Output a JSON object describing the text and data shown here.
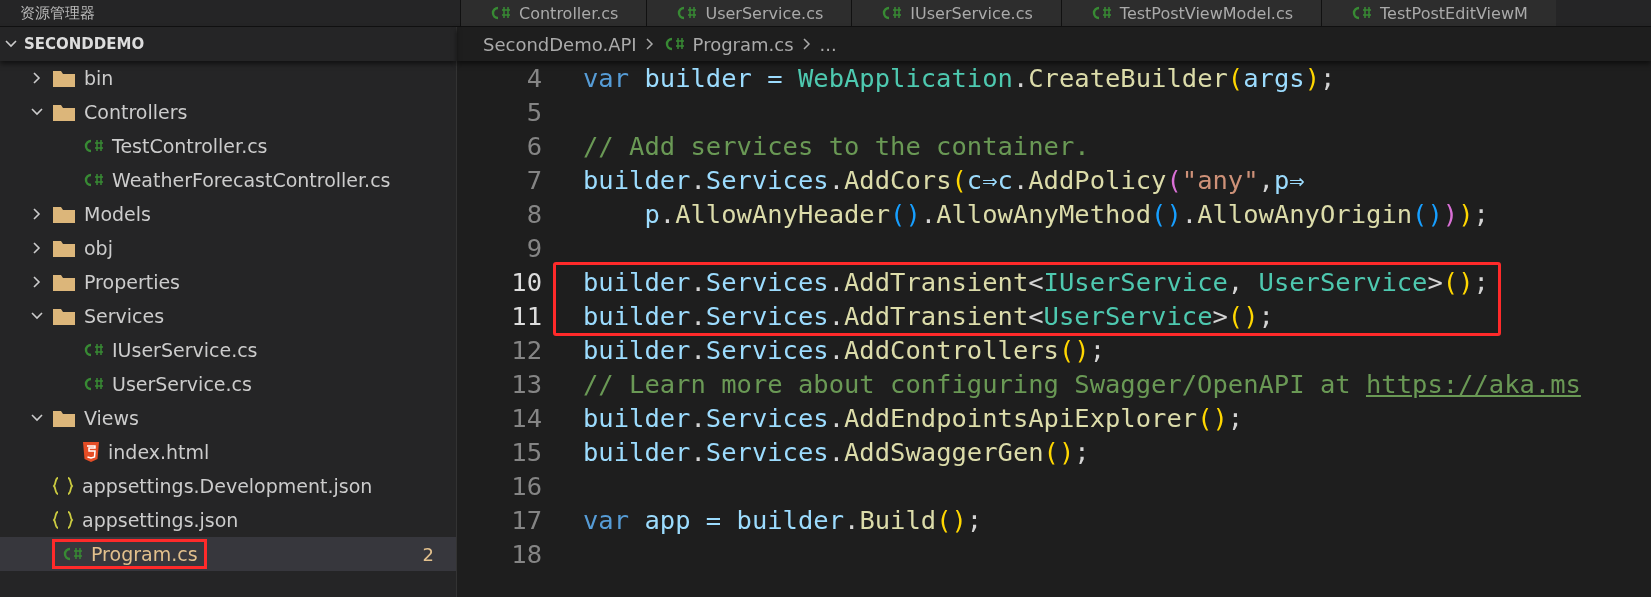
{
  "explorer": {
    "title": "资源管理器",
    "project": "SECONDDEMO"
  },
  "tabs": [
    {
      "label": "Controller.cs",
      "kind": "csharp"
    },
    {
      "label": "UserService.cs",
      "kind": "csharp"
    },
    {
      "label": "IUserService.cs",
      "kind": "csharp"
    },
    {
      "label": "TestPostViewModel.cs",
      "kind": "csharp"
    },
    {
      "label": "TestPostEditViewM",
      "kind": "csharp"
    }
  ],
  "tree": [
    {
      "label": "bin",
      "kind": "folder",
      "expanded": false,
      "selected": false
    },
    {
      "label": "Controllers",
      "kind": "folder",
      "expanded": true,
      "selected": false,
      "children": [
        {
          "label": "TestController.cs",
          "kind": "csharp",
          "selected": false
        },
        {
          "label": "WeatherForecastController.cs",
          "kind": "csharp",
          "selected": false
        }
      ]
    },
    {
      "label": "Models",
      "kind": "folder",
      "expanded": false,
      "selected": false
    },
    {
      "label": "obj",
      "kind": "folder",
      "expanded": false,
      "selected": false
    },
    {
      "label": "Properties",
      "kind": "folder",
      "expanded": false,
      "selected": false
    },
    {
      "label": "Services",
      "kind": "folder",
      "expanded": true,
      "selected": false,
      "children": [
        {
          "label": "IUserService.cs",
          "kind": "csharp",
          "selected": false
        },
        {
          "label": "UserService.cs",
          "kind": "csharp",
          "selected": false
        }
      ]
    },
    {
      "label": "Views",
      "kind": "folder",
      "expanded": true,
      "selected": false,
      "children": [
        {
          "label": "index.html",
          "kind": "html",
          "selected": false
        }
      ]
    },
    {
      "label": "appsettings.Development.json",
      "kind": "json",
      "selected": false
    },
    {
      "label": "appsettings.json",
      "kind": "json",
      "selected": false
    },
    {
      "label": "Program.cs",
      "kind": "csharp",
      "selected": true,
      "boxed": true,
      "badge": "2"
    }
  ],
  "breadcrumb": [
    "SecondDemo.API",
    "Program.cs",
    "..."
  ],
  "code": [
    {
      "number": "4",
      "boxed": false,
      "tokens": [
        {
          "kind": "kw",
          "text": "var "
        },
        {
          "kind": "id",
          "text": "builder = "
        },
        {
          "kind": "type",
          "text": "WebApplication"
        },
        {
          "kind": "p",
          "text": "."
        },
        {
          "kind": "fn",
          "text": "CreateBuilder"
        },
        {
          "kind": "b1",
          "text": "("
        },
        {
          "kind": "id",
          "text": "args"
        },
        {
          "kind": "b1",
          "text": ")"
        },
        {
          "kind": "p",
          "text": ";"
        }
      ]
    },
    {
      "number": "5",
      "boxed": false
    },
    {
      "number": "6",
      "boxed": false,
      "tokens": [
        {
          "kind": "cm",
          "text": "// Add services to the container."
        }
      ]
    },
    {
      "number": "7",
      "boxed": false,
      "tokens": [
        {
          "kind": "id",
          "text": "builder"
        },
        {
          "kind": "p",
          "text": "."
        },
        {
          "kind": "id",
          "text": "Services"
        },
        {
          "kind": "p",
          "text": "."
        },
        {
          "kind": "fn",
          "text": "AddCors"
        },
        {
          "kind": "b1",
          "text": "("
        },
        {
          "kind": "id",
          "text": "c⇒c"
        },
        {
          "kind": "p",
          "text": "."
        },
        {
          "kind": "fn",
          "text": "AddPolicy"
        },
        {
          "kind": "b2",
          "text": "("
        },
        {
          "kind": "str",
          "text": "\"any\""
        },
        {
          "kind": "p",
          "text": ","
        },
        {
          "kind": "id",
          "text": "p⇒"
        }
      ]
    },
    {
      "number": "8",
      "boxed": false,
      "tokens": [
        {
          "kind": "id",
          "text": "    p"
        },
        {
          "kind": "p",
          "text": "."
        },
        {
          "kind": "fn",
          "text": "AllowAnyHeader"
        },
        {
          "kind": "b3",
          "text": "()"
        },
        {
          "kind": "p",
          "text": "."
        },
        {
          "kind": "fn",
          "text": "AllowAnyMethod"
        },
        {
          "kind": "b3",
          "text": "()"
        },
        {
          "kind": "p",
          "text": "."
        },
        {
          "kind": "fn",
          "text": "AllowAnyOrigin"
        },
        {
          "kind": "b3",
          "text": "()"
        },
        {
          "kind": "b2",
          "text": ")"
        },
        {
          "kind": "b1",
          "text": ")"
        },
        {
          "kind": "p",
          "text": ";"
        }
      ]
    },
    {
      "number": "9",
      "boxed": false
    },
    {
      "number": "10",
      "boxed": true,
      "tokens": [
        {
          "kind": "id",
          "text": "builder"
        },
        {
          "kind": "p",
          "text": "."
        },
        {
          "kind": "id",
          "text": "Services"
        },
        {
          "kind": "p",
          "text": "."
        },
        {
          "kind": "fn",
          "text": "AddTransient"
        },
        {
          "kind": "p",
          "text": "<"
        },
        {
          "kind": "type",
          "text": "IUserService"
        },
        {
          "kind": "p",
          "text": ", "
        },
        {
          "kind": "type",
          "text": "UserService"
        },
        {
          "kind": "p",
          "text": ">"
        },
        {
          "kind": "b1",
          "text": "()"
        },
        {
          "kind": "p",
          "text": ";"
        }
      ]
    },
    {
      "number": "11",
      "boxed": true,
      "tokens": [
        {
          "kind": "id",
          "text": "builder"
        },
        {
          "kind": "p",
          "text": "."
        },
        {
          "kind": "id",
          "text": "Services"
        },
        {
          "kind": "p",
          "text": "."
        },
        {
          "kind": "fn",
          "text": "AddTransient"
        },
        {
          "kind": "p",
          "text": "<"
        },
        {
          "kind": "type",
          "text": "UserService"
        },
        {
          "kind": "p",
          "text": ">"
        },
        {
          "kind": "b1",
          "text": "()"
        },
        {
          "kind": "p",
          "text": ";"
        }
      ]
    },
    {
      "number": "12",
      "boxed": false,
      "tokens": [
        {
          "kind": "id",
          "text": "builder"
        },
        {
          "kind": "p",
          "text": "."
        },
        {
          "kind": "id",
          "text": "Services"
        },
        {
          "kind": "p",
          "text": "."
        },
        {
          "kind": "fn",
          "text": "AddControllers"
        },
        {
          "kind": "b1",
          "text": "()"
        },
        {
          "kind": "p",
          "text": ";"
        }
      ]
    },
    {
      "number": "13",
      "boxed": false,
      "tokens": [
        {
          "kind": "cm",
          "text": "// Learn more about configuring Swagger/OpenAPI at "
        },
        {
          "kind": "link",
          "text": "https://aka.ms"
        }
      ]
    },
    {
      "number": "14",
      "boxed": false,
      "tokens": [
        {
          "kind": "id",
          "text": "builder"
        },
        {
          "kind": "p",
          "text": "."
        },
        {
          "kind": "id",
          "text": "Services"
        },
        {
          "kind": "p",
          "text": "."
        },
        {
          "kind": "fn",
          "text": "AddEndpointsApiExplorer"
        },
        {
          "kind": "b1",
          "text": "()"
        },
        {
          "kind": "p",
          "text": ";"
        }
      ]
    },
    {
      "number": "15",
      "boxed": false,
      "tokens": [
        {
          "kind": "id",
          "text": "builder"
        },
        {
          "kind": "p",
          "text": "."
        },
        {
          "kind": "id",
          "text": "Services"
        },
        {
          "kind": "p",
          "text": "."
        },
        {
          "kind": "fn",
          "text": "AddSwaggerGen"
        },
        {
          "kind": "b1",
          "text": "()"
        },
        {
          "kind": "p",
          "text": ";"
        }
      ]
    },
    {
      "number": "16",
      "boxed": false
    },
    {
      "number": "17",
      "boxed": false,
      "tokens": [
        {
          "kind": "kw",
          "text": "var "
        },
        {
          "kind": "id",
          "text": "app = builder"
        },
        {
          "kind": "p",
          "text": "."
        },
        {
          "kind": "fn",
          "text": "Build"
        },
        {
          "kind": "b1",
          "text": "()"
        },
        {
          "kind": "p",
          "text": ";"
        }
      ]
    },
    {
      "number": "18",
      "boxed": false
    }
  ]
}
